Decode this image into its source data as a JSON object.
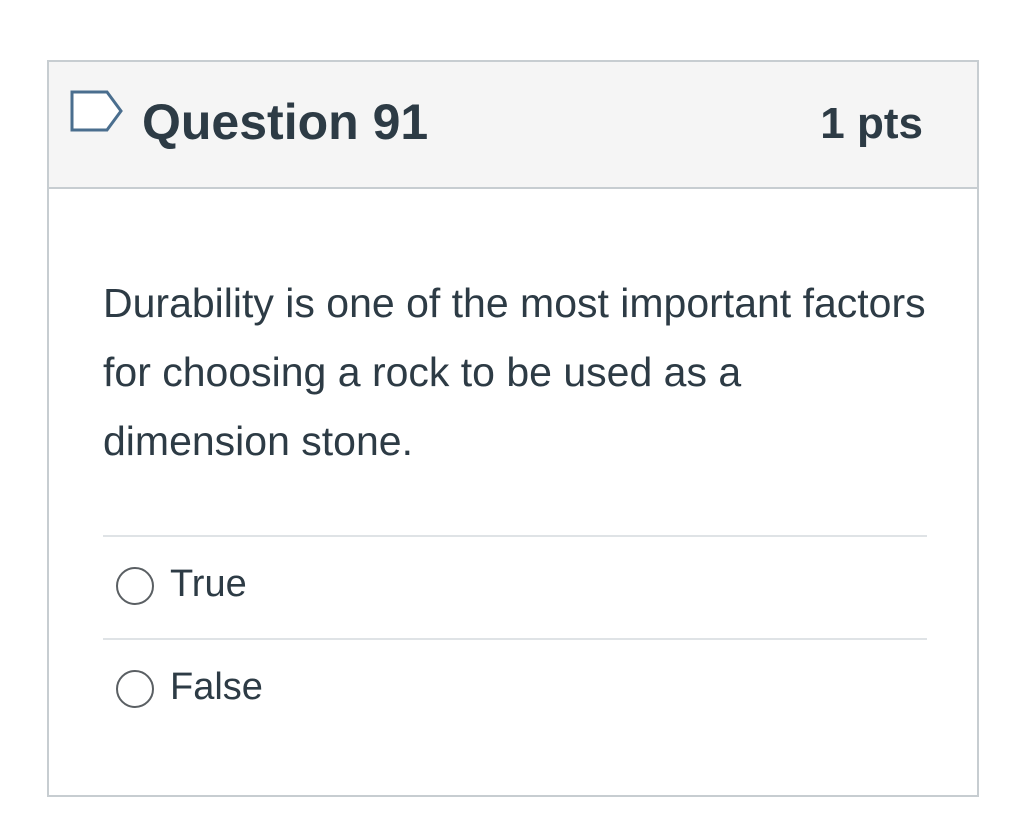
{
  "question": {
    "title": "Question 91",
    "points": "1 pts",
    "text": "Durability is one of the most important factors for choosing a rock to be used as a dimension stone.",
    "flag_icon": "flag-outline-icon"
  },
  "answers": [
    {
      "label": "True",
      "selected": false
    },
    {
      "label": "False",
      "selected": false
    }
  ],
  "colors": {
    "text": "#2d3b45",
    "header_bg": "#f5f5f5",
    "border": "#c7cdd1",
    "flag_stroke": "#4a6e8e"
  }
}
